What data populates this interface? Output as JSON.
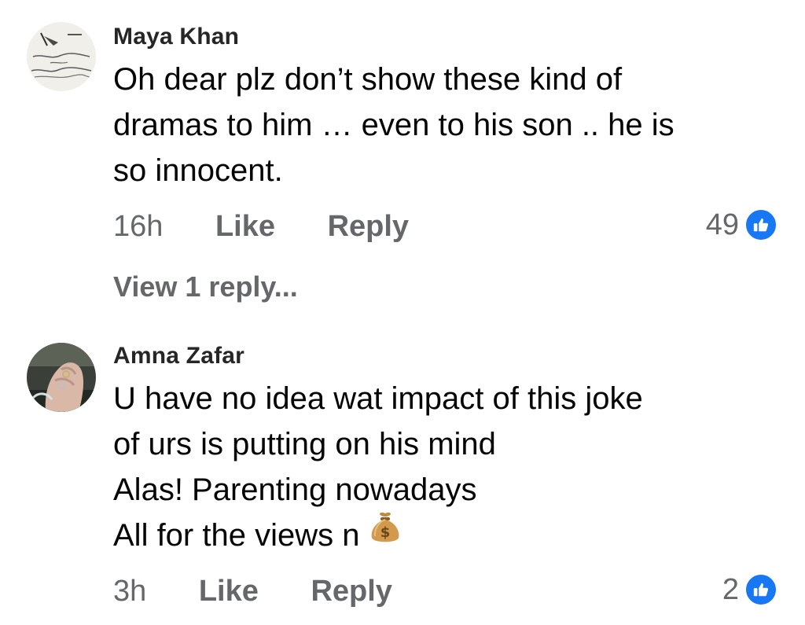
{
  "comments": [
    {
      "author": "Maya Khan",
      "avatar_icon": "calligraphy-text-avatar",
      "lines": [
        "Oh dear plz don’t show these kind of",
        "dramas to him … even to his son .. he is",
        "so innocent."
      ],
      "time": "16h",
      "like_label": "Like",
      "reply_label": "Reply",
      "reaction_count": "49",
      "reaction_icon": "thumbs-up-icon",
      "view_replies": "View 1 reply..."
    },
    {
      "author": "Amna Zafar",
      "avatar_icon": "hands-with-rings-avatar",
      "lines": [
        "U have no idea wat impact of this joke",
        "of urs is putting on his mind",
        "Alas! Parenting nowadays",
        "All for the views n"
      ],
      "emoji": "money-bag-icon",
      "time": "3h",
      "like_label": "Like",
      "reply_label": "Reply",
      "reaction_count": "2",
      "reaction_icon": "thumbs-up-icon"
    }
  ],
  "colors": {
    "meta_gray": "#65676b",
    "like_blue": "#1877f2",
    "text": "#050505"
  }
}
